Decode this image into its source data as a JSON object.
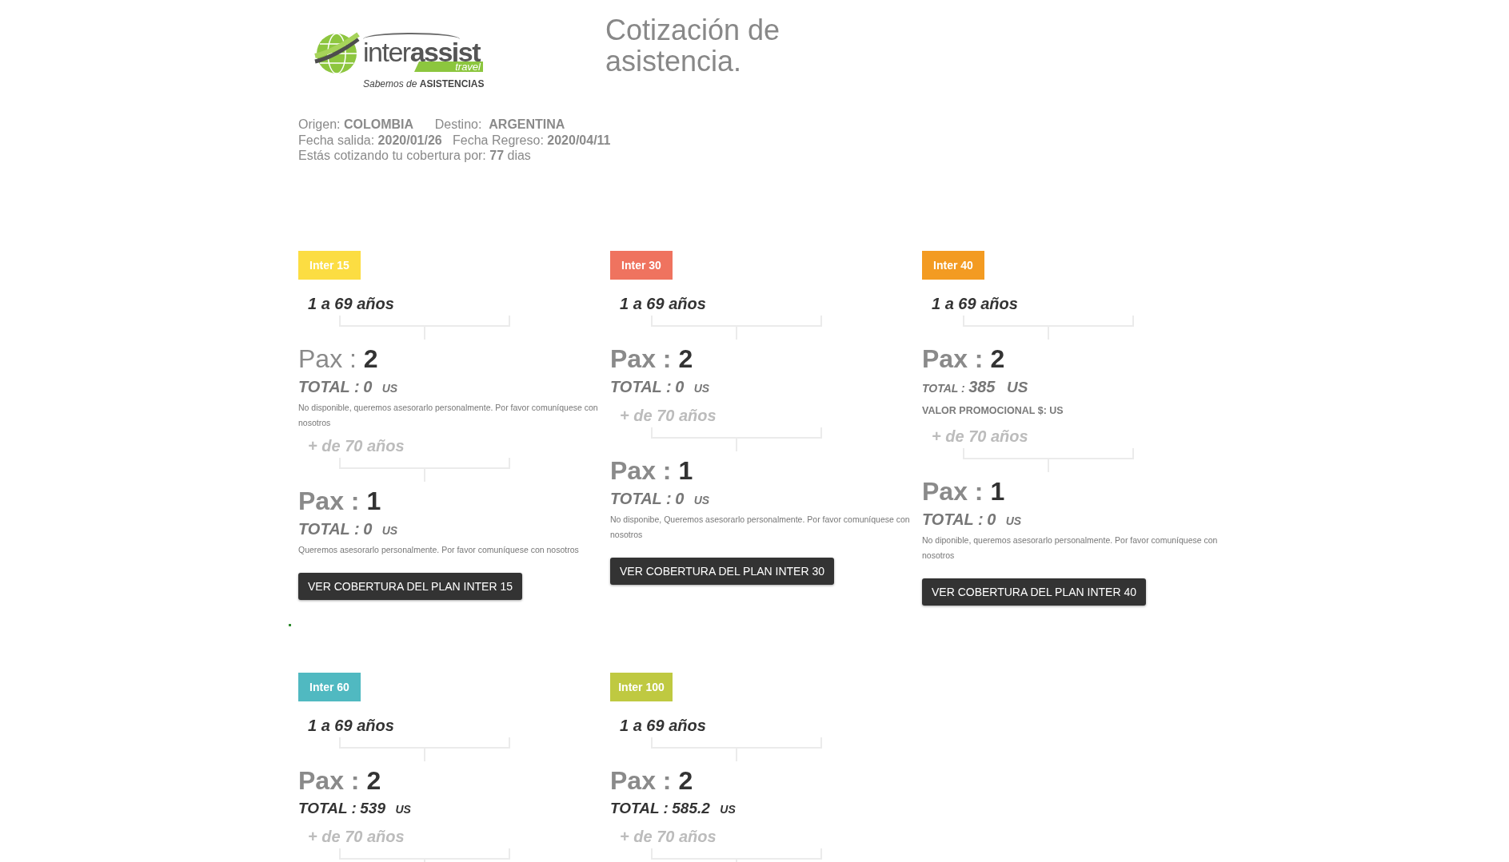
{
  "logo": {
    "brand": "inter**assist**",
    "sub": "travel",
    "tagline": "*Sabemos de* **ASISTENCIAS**"
  },
  "title": "Cotización de asistencia.",
  "trip_info": [
    "Origen: **COLOMBIA**      Destino:  **ARGENTINA**",
    "Fecha salida: **2020/01/26**   Fecha Regreso: **2020/04/11**",
    "Estás cotizando tu cobertura por: **77** dias"
  ],
  "plans": [
    {
      "name": "Inter 15",
      "color": "#fcdd42",
      "groups": [
        {
          "age_range": "1 a 69 años",
          "muted": false,
          "pax_label": "Pax :",
          "pax_count": "2",
          "pax_label_bold": false,
          "total": {
            "label": "TOTAL :",
            "amount": "0",
            "currency": "US",
            "kind": "standard"
          },
          "note": "No disponible, queremos asesorarlo personalmente. Por favor comuníquese con nosotros"
        },
        {
          "age_range": "+ de 70 años",
          "muted": true,
          "pax_label": "Pax :",
          "pax_count": "1",
          "pax_label_bold": true,
          "total": {
            "label": "TOTAL :",
            "amount": "0",
            "currency": "US",
            "kind": "standard"
          },
          "note": "Queremos asesorarlo personalmente. Por favor comuníquese con nosotros"
        }
      ],
      "button": "VER COBERTURA DEL PLAN INTER 15"
    },
    {
      "name": "Inter 30",
      "color": "#ef735f",
      "groups": [
        {
          "age_range": "1 a 69 años",
          "muted": false,
          "pax_label": "Pax :",
          "pax_count": "2",
          "pax_label_bold": true,
          "total": {
            "label": "TOTAL :",
            "amount": "0",
            "currency": "US",
            "kind": "standard"
          }
        },
        {
          "age_range": "+ de 70 años",
          "muted": true,
          "pax_label": "Pax :",
          "pax_count": "1",
          "pax_label_bold": true,
          "total": {
            "label": "TOTAL :",
            "amount": "0",
            "currency": "US",
            "kind": "standard"
          },
          "note": "No disponibe, Queremos asesorarlo personalmente. Por favor comuníquese con nosotros"
        }
      ],
      "button": "VER COBERTURA DEL PLAN INTER 30"
    },
    {
      "name": "Inter 40",
      "color": "#f39b22",
      "groups": [
        {
          "age_range": "1 a 69 años",
          "muted": false,
          "pax_label": "Pax :",
          "pax_count": "2",
          "pax_label_bold": true,
          "total": {
            "label": "TOTAL :",
            "amount": "385",
            "currency": "US",
            "kind": "compact"
          },
          "promo": "VALOR PROMOCIONAL $: US"
        },
        {
          "age_range": "+ de 70 años",
          "muted": true,
          "pax_label": "Pax :",
          "pax_count": "1",
          "pax_label_bold": true,
          "total": {
            "label": "TOTAL :",
            "amount": "0",
            "currency": "US",
            "kind": "standard"
          },
          "note": "No diponible, queremos asesorarlo personalmente. Por favor comuníquese con nosotros"
        }
      ],
      "button": "VER COBERTURA DEL PLAN INTER 40"
    },
    {
      "name": "Inter 60",
      "color": "#50b9c1",
      "groups": [
        {
          "age_range": "1 a 69 años",
          "muted": false,
          "pax_label": "Pax :",
          "pax_count": "2",
          "pax_label_bold": true,
          "total": {
            "label": "TOTAL :",
            "amount": "539",
            "currency": "US",
            "kind": "dark"
          }
        },
        {
          "age_range": "+ de 70 años",
          "muted": true
        }
      ]
    },
    {
      "name": "Inter 100",
      "color": "#bfc941",
      "groups": [
        {
          "age_range": "1 a 69 años",
          "muted": false,
          "pax_label": "Pax :",
          "pax_count": "2",
          "pax_label_bold": true,
          "total": {
            "label": "TOTAL :",
            "amount": "585.2",
            "currency": "US",
            "kind": "dark"
          }
        },
        {
          "age_range": "+ de 70 años",
          "muted": true
        }
      ]
    }
  ]
}
